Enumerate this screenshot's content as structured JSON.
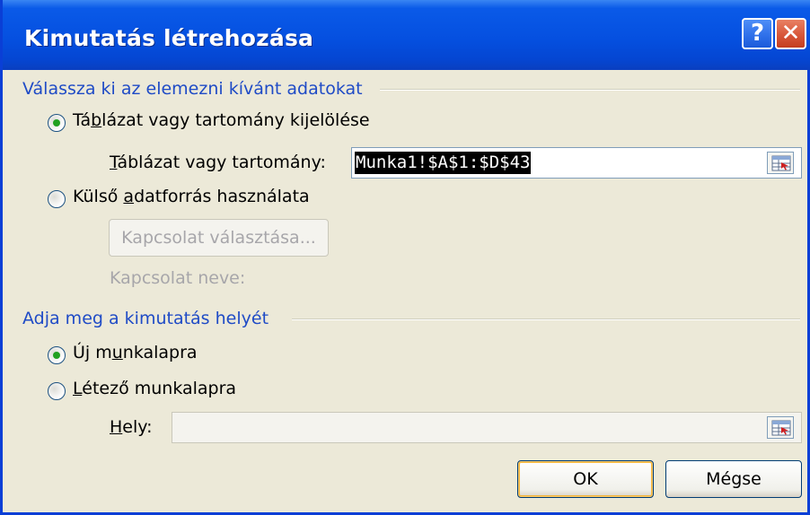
{
  "window": {
    "title": "Kimutatás létrehozása",
    "help_glyph": "?",
    "close_glyph": "✕"
  },
  "source_group": {
    "heading": "Válassza ki az elemezni kívánt adatokat",
    "option_table": {
      "pre": "Tá",
      "ul": "b",
      "post": "lázat vagy tartomány kijelölése",
      "selected": true
    },
    "table_label": {
      "ul": "T",
      "post": "áblázat vagy tartomány:"
    },
    "table_value": "Munka1!$A$1:$D$43",
    "option_external": {
      "pre": "Külső ",
      "ul": "a",
      "post": "datforrás használata",
      "selected": false
    },
    "choose_connection": "Kapcsolat választása...",
    "connection_name": "Kapcsolat neve:"
  },
  "location_group": {
    "heading": "Adja meg a kimutatás helyét",
    "option_new": {
      "pre": "Új m",
      "ul": "u",
      "post": "nkalapra",
      "selected": true
    },
    "option_existing": {
      "pre": "",
      "ul": "L",
      "post": "étező munkalapra",
      "selected": false
    },
    "location_label": {
      "ul": "H",
      "post": "ely:"
    },
    "location_value": ""
  },
  "buttons": {
    "ok": "OK",
    "cancel": "Mégse"
  },
  "colors": {
    "titlebar": "#0550e0",
    "group_heading": "#1f4bc6",
    "radio_dot": "#21a121",
    "disabled_text": "#a7a6aa"
  }
}
